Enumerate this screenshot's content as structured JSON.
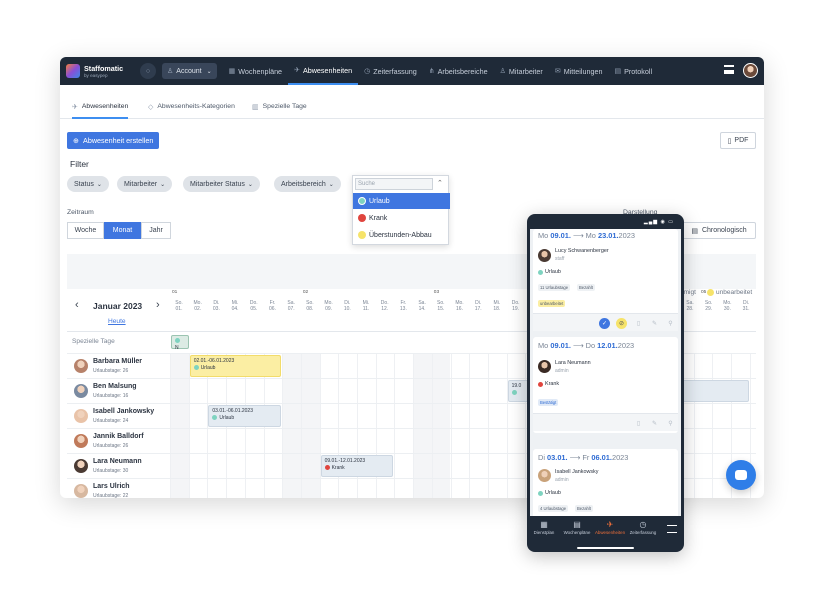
{
  "topbar": {
    "brand": "Staffomatic",
    "brand_sub": "by easypep",
    "account_label": "Account",
    "nav": [
      {
        "label": "Wochenpläne",
        "icon": "calendar-icon"
      },
      {
        "label": "Abwesenheiten",
        "icon": "plane-icon",
        "active": true
      },
      {
        "label": "Zeiterfassung",
        "icon": "clock-icon"
      },
      {
        "label": "Arbeitsbereiche",
        "icon": "sitemap-icon"
      },
      {
        "label": "Mitarbeiter",
        "icon": "user-icon"
      },
      {
        "label": "Mitteilungen",
        "icon": "mail-icon"
      },
      {
        "label": "Protokoll",
        "icon": "doc-icon"
      }
    ]
  },
  "tabs": [
    {
      "label": "Abwesenheiten",
      "active": true
    },
    {
      "label": "Abwesenheits-Kategorien"
    },
    {
      "label": "Spezielle Tage"
    }
  ],
  "actions": {
    "create_label": "Abwesenheit erstellen",
    "pdf_label": "PDF"
  },
  "filter": {
    "title": "Filter",
    "chips": [
      "Status",
      "Mitarbeiter",
      "Mitarbeiter Status",
      "Arbeitsbereich"
    ],
    "search_placeholder": "Suche",
    "options": [
      {
        "label": "Urlaub",
        "color": "#7ed3c0",
        "selected": true
      },
      {
        "label": "Krank",
        "color": "#e0453e"
      },
      {
        "label": "Überstunden-Abbau",
        "color": "#f6e36a"
      }
    ]
  },
  "range": {
    "label": "Zeitraum",
    "options": [
      "Woche",
      "Monat",
      "Jahr"
    ],
    "active": "Monat"
  },
  "view": {
    "label": "Darstellung",
    "chrono_label": "Chronologisch"
  },
  "calendar": {
    "month": "Januar 2023",
    "today": "Heute",
    "weeks": [
      "01",
      "02",
      "03",
      "05"
    ],
    "days": [
      [
        "So.",
        "01."
      ],
      [
        "Mo.",
        "02."
      ],
      [
        "Di.",
        "03."
      ],
      [
        "Mi.",
        "04."
      ],
      [
        "Do.",
        "05."
      ],
      [
        "Fr.",
        "06."
      ],
      [
        "Sa.",
        "07."
      ],
      [
        "So.",
        "08."
      ],
      [
        "Mo.",
        "09."
      ],
      [
        "Di.",
        "10."
      ],
      [
        "Mi.",
        "11."
      ],
      [
        "Do.",
        "12."
      ],
      [
        "Fr.",
        "13."
      ],
      [
        "Sa.",
        "14."
      ],
      [
        "So.",
        "15."
      ],
      [
        "Mo.",
        "16."
      ],
      [
        "Di.",
        "17."
      ],
      [
        "Mi.",
        "18."
      ],
      [
        "Do.",
        "19."
      ]
    ],
    "days_right": [
      [
        "Sa.",
        "28."
      ],
      [
        "So.",
        "29."
      ],
      [
        "Mo.",
        "30."
      ],
      [
        "Di.",
        "31."
      ]
    ],
    "special_label": "Spezielle Tage",
    "special_chip": "N",
    "legend": [
      "hmigt",
      "unbearbeitet"
    ],
    "people": [
      {
        "name": "Barbara Müller",
        "sub": "Urlaubstage: 26"
      },
      {
        "name": "Ben Malsung",
        "sub": "Urlaubstage: 16"
      },
      {
        "name": "Isabell Jankowsky",
        "sub": "Urlaubstage: 24"
      },
      {
        "name": "Jannik Balldorf",
        "sub": "Urlaubstage: 26"
      },
      {
        "name": "Lara Neumann",
        "sub": "Urlaubstage: 30"
      },
      {
        "name": "Lars Ulrich",
        "sub": "Urlaubstage: 22"
      }
    ],
    "bars": [
      {
        "dates": "02.01.-06.01.2023",
        "type": "Urlaub"
      },
      {
        "dates": "03.01.-06.01.2023",
        "type": "Urlaub"
      },
      {
        "dates": "09.01.-12.01.2023",
        "type": "Krank"
      },
      {
        "dates": "19.0",
        "type": ""
      }
    ]
  },
  "phone": {
    "cards": [
      {
        "from_day": "Mo",
        "from": "09.01.",
        "to_day": "Mo",
        "to": "23.01.",
        "year": "2023",
        "name": "Lucy Schwanenberger",
        "role": "staff",
        "type": "Urlaub",
        "tags": [
          "11 Urlaubstage",
          "Bezahlt"
        ],
        "status": "unbearbeitet"
      },
      {
        "from_day": "Mo",
        "from": "09.01.",
        "to_day": "Do",
        "to": "12.01.",
        "year": "2023",
        "name": "Lara Neumann",
        "role": "admin",
        "type": "Krank",
        "status": "Bestätigt"
      },
      {
        "from_day": "Di",
        "from": "03.01.",
        "to_day": "Fr",
        "to": "06.01.",
        "year": "2023",
        "name": "Isabell Jankowsky",
        "role": "admin",
        "type": "Urlaub",
        "tags": [
          "4 Urlaubstage",
          "Bezahlt"
        ]
      }
    ],
    "nav": [
      {
        "label": "Dienstplan",
        "icon": "calendar-icon"
      },
      {
        "label": "Wochenpläne",
        "icon": "grid-icon"
      },
      {
        "label": "Abwesenheiten",
        "icon": "plane-icon",
        "active": true
      },
      {
        "label": "Zeiterfassung",
        "icon": "clock-icon"
      }
    ]
  }
}
